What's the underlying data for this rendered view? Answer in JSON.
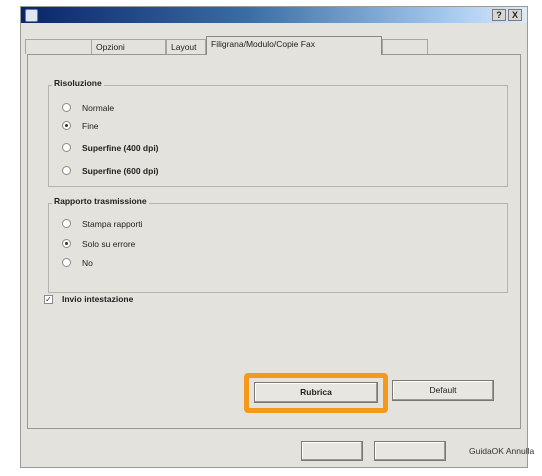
{
  "window": {
    "help_btn": "?",
    "close_btn": "X"
  },
  "tabs": [
    {
      "label": "Opzioni"
    },
    {
      "label": "Layout"
    },
    {
      "label": "Filigrana/Modulo/Copie Fax"
    }
  ],
  "resolution": {
    "title": "Risoluzione",
    "options": [
      {
        "label": "Normale",
        "selected": false
      },
      {
        "label": "Fine",
        "selected": true
      },
      {
        "label": "Superfine (400 dpi)",
        "selected": false
      },
      {
        "label": "Superfine (600 dpi)",
        "selected": false
      }
    ]
  },
  "report": {
    "title": "Rapporto trasmissione",
    "options": [
      {
        "label": "Stampa rapporti",
        "selected": false
      },
      {
        "label": "Solo su errore",
        "selected": true
      },
      {
        "label": "No",
        "selected": false
      }
    ]
  },
  "header_checkbox": {
    "label": "Invio intestazione",
    "checked": true,
    "mark": "✓"
  },
  "buttons": {
    "rubrica": "Rubrica",
    "default": "Default"
  },
  "footer": {
    "text": "GuidaOK Annulla"
  },
  "colors": {
    "highlight": "#f39a1b",
    "titlebar": "#0a246a"
  }
}
